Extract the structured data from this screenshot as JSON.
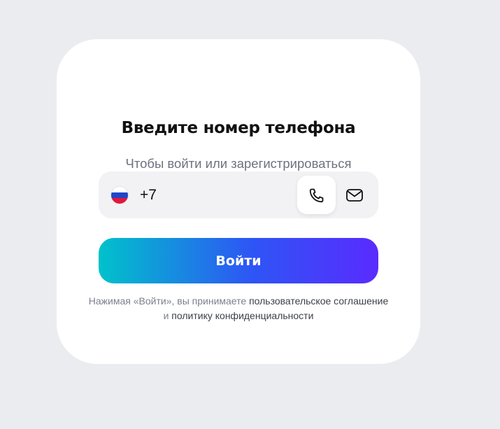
{
  "login": {
    "title": "Введите номер телефона",
    "subtitle": "Чтобы войти или зарегистрироваться",
    "phone": {
      "country_flag": "russia-flag",
      "prefix": "+7",
      "value": "",
      "placeholder": ""
    },
    "mode_toggle": {
      "selected": "phone",
      "phone_icon": "phone-icon",
      "email_icon": "mail-icon"
    },
    "submit_label": "Войти",
    "terms": {
      "prefix": "Нажимая «Войти», вы принимаете",
      "user_agreement_link": "пользовательское соглашение",
      "conjunction": "и",
      "privacy_policy_link": "политику конфиденциальности"
    }
  },
  "colors": {
    "background": "#ebecef",
    "card": "#ffffff",
    "field": "#f2f2f4",
    "gradient_start": "#00c2cb",
    "gradient_mid": "#2e55f5",
    "gradient_end": "#5a2bff",
    "muted_text": "#7a808c",
    "link_text": "#3b3f4a"
  }
}
